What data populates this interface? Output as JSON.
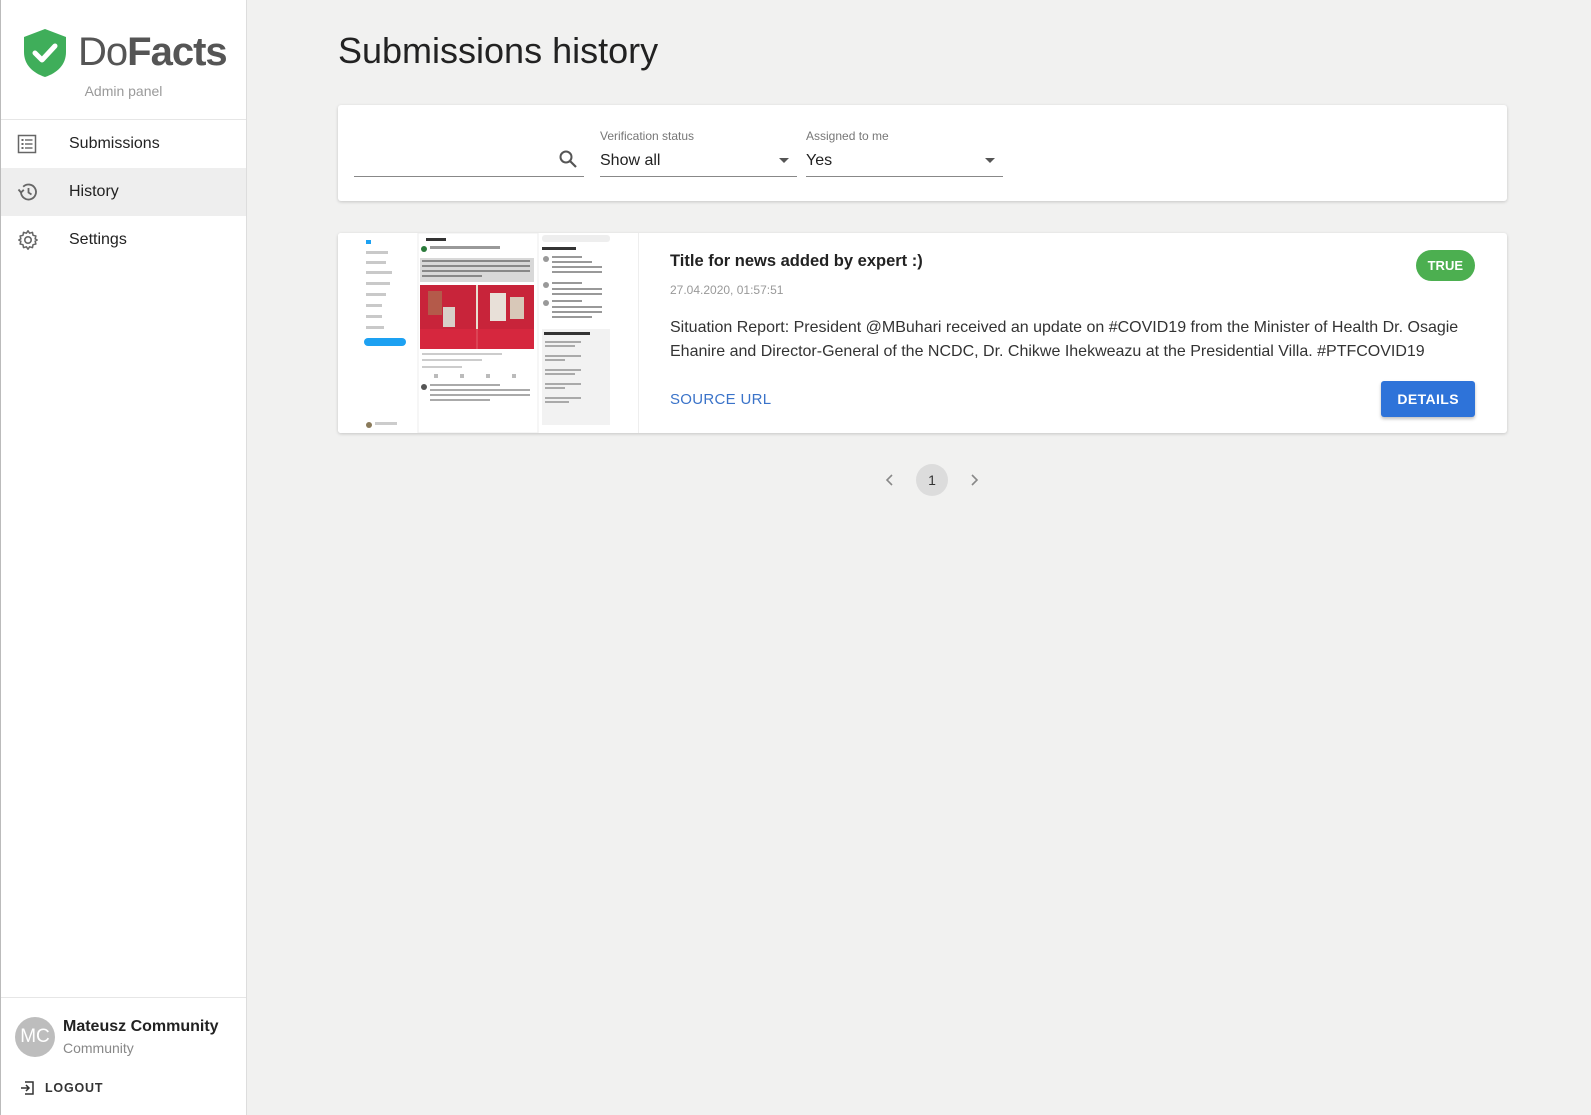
{
  "brand": {
    "name_light": "Do",
    "name_bold": "Facts",
    "subtitle": "Admin panel"
  },
  "sidebar": {
    "items": [
      {
        "label": "Submissions",
        "icon": "list-icon",
        "active": false
      },
      {
        "label": "History",
        "icon": "history-icon",
        "active": true
      },
      {
        "label": "Settings",
        "icon": "gear-icon",
        "active": false
      }
    ]
  },
  "user": {
    "initials": "MC",
    "name": "Mateusz Community",
    "role": "Community",
    "logout_label": "LOGOUT"
  },
  "page": {
    "title": "Submissions history"
  },
  "filters": {
    "search": {
      "value": "",
      "placeholder": ""
    },
    "verification": {
      "caption": "Verification status",
      "value": "Show all"
    },
    "assigned": {
      "caption": "Assigned to me",
      "value": "Yes"
    }
  },
  "submissions": [
    {
      "title": "Title for news added by expert :)",
      "date": "27.04.2020, 01:57:51",
      "text": "Situation Report: President @MBuhari received an update on #COVID19 from the Minister of Health Dr. Osagie Ehanire and Director-General of the NCDC, Dr. Chikwe Ihekweazu at the Presidential Villa. #PTFCOVID19",
      "source_label": "SOURCE URL",
      "badge": "TRUE",
      "details_label": "DETAILS"
    }
  ],
  "pagination": {
    "current": "1"
  },
  "colors": {
    "accent": "#2e73d9",
    "badge_true": "#4caf50",
    "brand_green": "#3fae5a",
    "link": "#3a73c9"
  }
}
